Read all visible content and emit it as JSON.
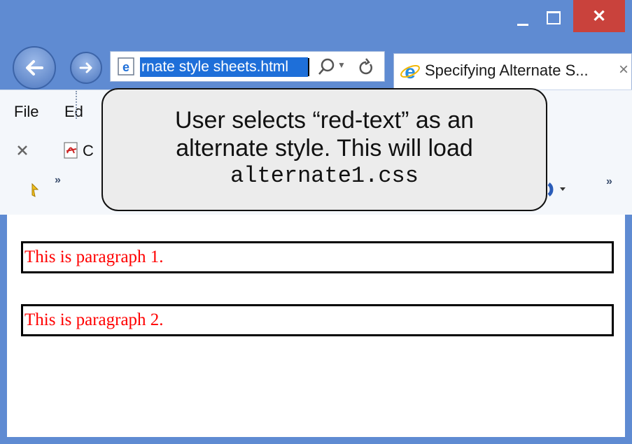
{
  "window": {
    "minimize_label": "",
    "maximize_label": "",
    "close_label": "✕"
  },
  "address_bar": {
    "url_visible": "rnate style sheets.html"
  },
  "tab": {
    "title": "Specifying Alternate S...",
    "close_glyph": "×"
  },
  "menu": {
    "items": [
      "File",
      "Ed"
    ]
  },
  "favorites_bar": {
    "item_partial": "C"
  },
  "callout": {
    "line1": "User selects “red-text” as an",
    "line2": "alternate style.  This will load",
    "code": "alternate1.css"
  },
  "content": {
    "paragraph1": "This is paragraph 1.",
    "paragraph2": "This is paragraph 2.",
    "text_color": "#ff0000"
  },
  "colors": {
    "frame": "#5f8bd2",
    "close_button": "#c9423c",
    "url_highlight": "#1e6fd9"
  },
  "icons": {
    "back": "back-arrow-icon",
    "forward": "forward-arrow-icon",
    "favicon": "ie-page-icon",
    "search": "search-icon",
    "refresh": "refresh-icon",
    "tab_icon": "ie-logo-icon",
    "stop": "stop-x-icon",
    "pdf": "pdf-icon",
    "favorites_star": "favorites-star-icon"
  }
}
